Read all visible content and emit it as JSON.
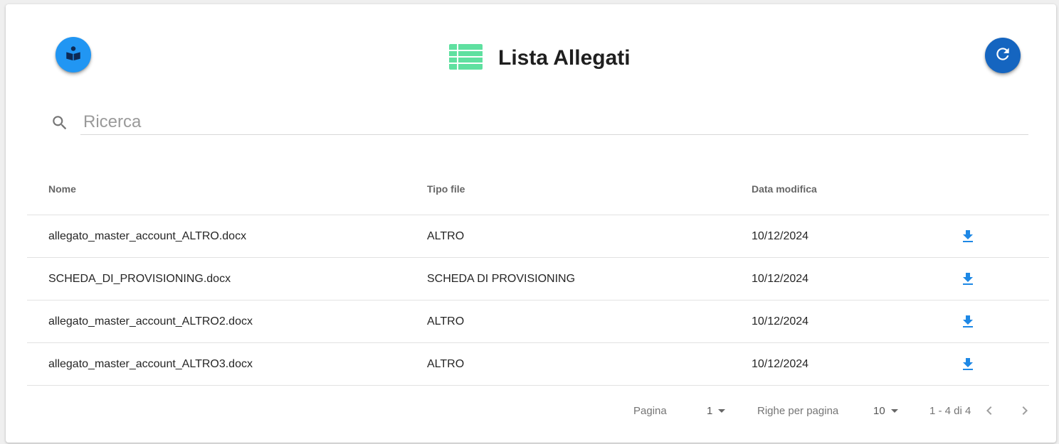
{
  "header": {
    "title": "Lista Allegati",
    "left_button_icon": "book-reader-icon",
    "right_button_icon": "refresh-icon",
    "title_icon": "table-list-icon"
  },
  "colors": {
    "fab_left": "#2196f3",
    "fab_right": "#1565c0",
    "title_icon": "#5fe0a0",
    "download_icon": "#1e88e5"
  },
  "search": {
    "placeholder": "Ricerca",
    "value": ""
  },
  "table": {
    "columns": [
      "Nome",
      "Tipo file",
      "Data modifica"
    ],
    "rows": [
      {
        "nome": "allegato_master_account_ALTRO.docx",
        "tipo": "ALTRO",
        "data": "10/12/2024",
        "action_icon": "download-icon"
      },
      {
        "nome": "SCHEDA_DI_PROVISIONING.docx",
        "tipo": "SCHEDA DI PROVISIONING",
        "data": "10/12/2024",
        "action_icon": "download-icon"
      },
      {
        "nome": "allegato_master_account_ALTRO2.docx",
        "tipo": "ALTRO",
        "data": "10/12/2024",
        "action_icon": "download-icon"
      },
      {
        "nome": "allegato_master_account_ALTRO3.docx",
        "tipo": "ALTRO",
        "data": "10/12/2024",
        "action_icon": "download-icon"
      }
    ]
  },
  "pagination": {
    "page_label": "Pagina",
    "page_value": "1",
    "rows_label": "Righe per pagina",
    "rows_value": "10",
    "range_text": "1 - 4 di 4"
  }
}
